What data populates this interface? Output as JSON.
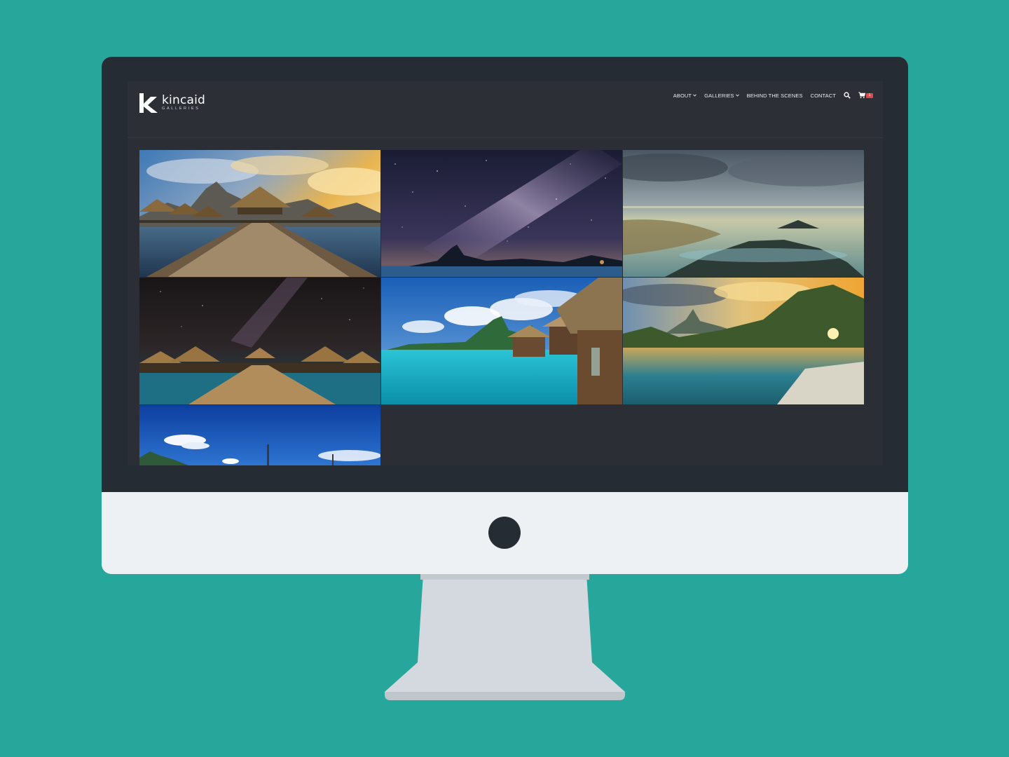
{
  "brand": {
    "name": "kincaid",
    "subtitle": "GALLERIES"
  },
  "nav": {
    "items": [
      {
        "label": "ABOUT",
        "has_dropdown": true
      },
      {
        "label": "GALLERIES",
        "has_dropdown": true
      },
      {
        "label": "BEHIND THE SCENES",
        "has_dropdown": false
      },
      {
        "label": "CONTACT",
        "has_dropdown": false
      }
    ],
    "search_icon": "search-icon",
    "cart_icon": "cart-icon",
    "cart_count": "1"
  },
  "gallery": {
    "photos": [
      {
        "subject": "overwater bungalow boardwalk at sunset"
      },
      {
        "subject": "milky way over island mountain"
      },
      {
        "subject": "long exposure misty rocky shoreline"
      },
      {
        "subject": "overwater bungalows under night sky"
      },
      {
        "subject": "turquoise lagoon with overwater bungalows"
      },
      {
        "subject": "palm trees reflected in lagoon at sunset"
      },
      {
        "subject": "blue sky over island"
      }
    ]
  },
  "colors": {
    "background": "#27a79b",
    "bezel": "#262c33",
    "site_background": "#2b2f35",
    "cart_badge": "#e0484c"
  }
}
